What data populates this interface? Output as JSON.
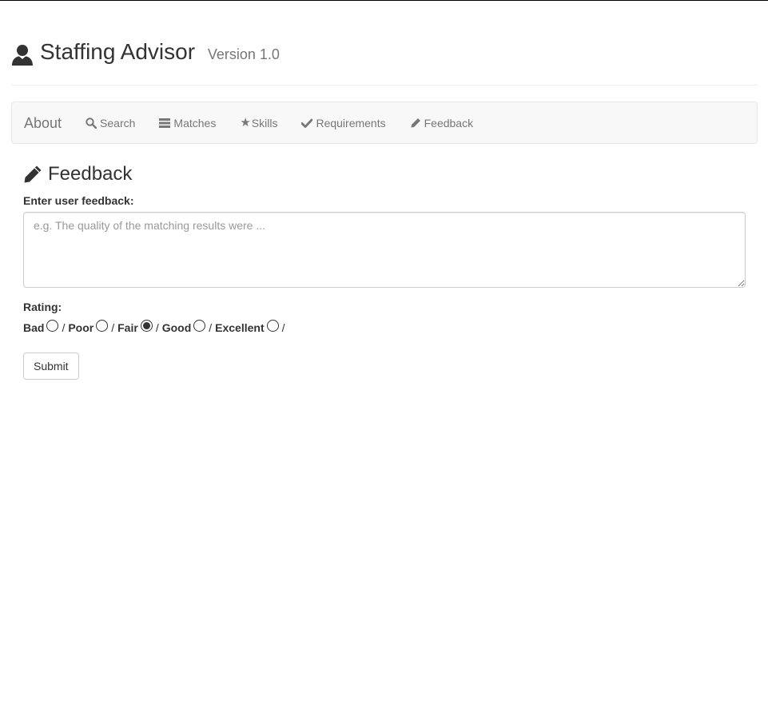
{
  "header": {
    "icon": "user-icon",
    "title": "Staffing Advisor",
    "version": "Version 1.0"
  },
  "navbar": {
    "brand": "About",
    "items": [
      {
        "icon": "search-icon",
        "label": "Search"
      },
      {
        "icon": "list-icon",
        "label": "Matches"
      },
      {
        "icon": "star-icon",
        "label": "Skills"
      },
      {
        "icon": "check-icon",
        "label": "Requirements"
      },
      {
        "icon": "pencil-icon",
        "label": "Feedback"
      }
    ]
  },
  "feedback": {
    "title": "Feedback",
    "input_label": "Enter user feedback:",
    "placeholder": "e.g. The quality of the matching results were ...",
    "value": "",
    "rating_label": "Rating:",
    "rating_options": [
      "Bad",
      "Poor",
      "Fair",
      "Good",
      "Excellent"
    ],
    "selected_rating": "Fair",
    "separator": "/",
    "submit_label": "Submit"
  },
  "colors": {
    "text": "#333333",
    "muted": "#777777",
    "navbar_bg": "#f8f8f8",
    "border": "#cccccc"
  }
}
